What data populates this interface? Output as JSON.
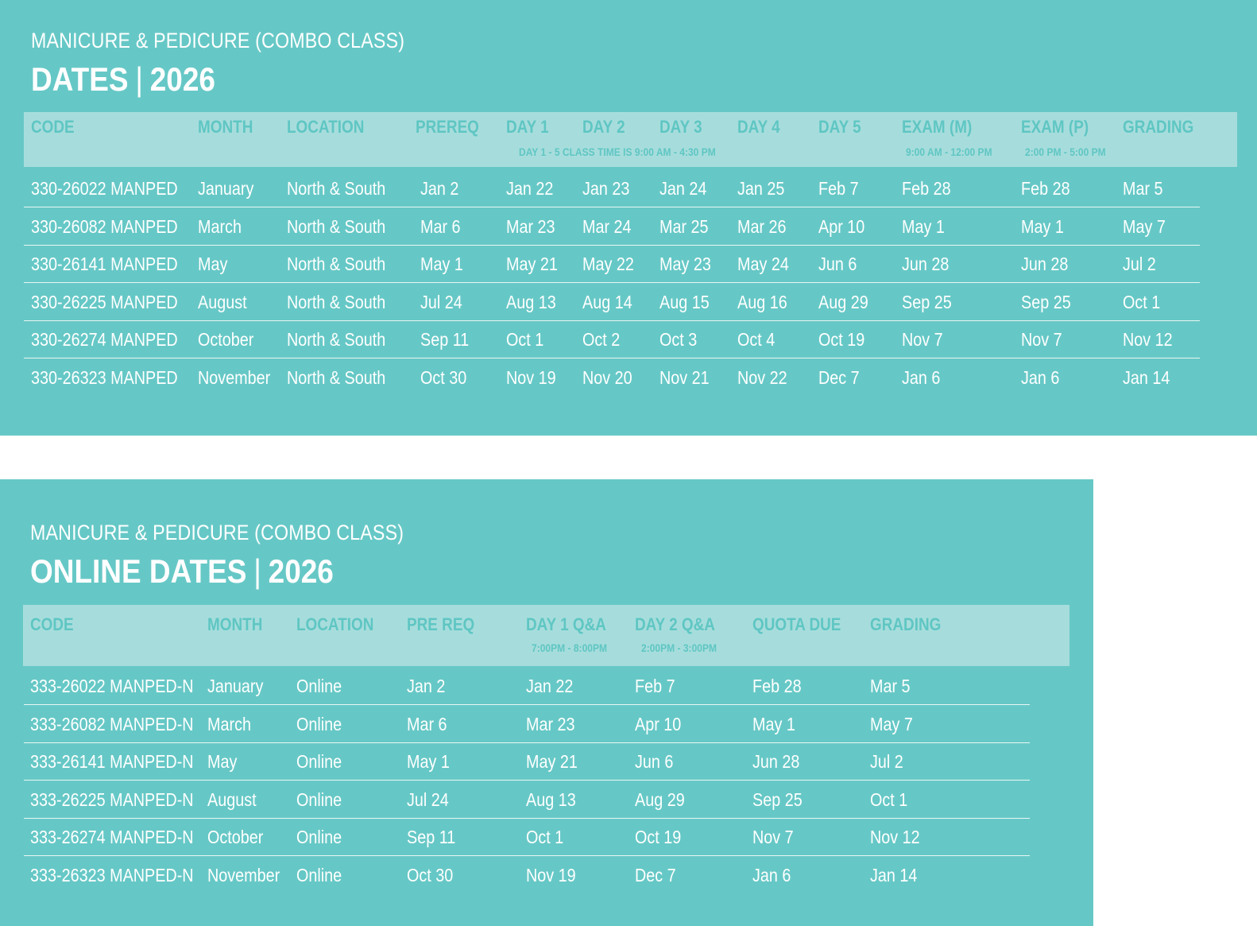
{
  "table1": {
    "subtitle": "MANICURE & PEDICURE (COMBO CLASS)",
    "title_main": "DATES",
    "title_sep": "|",
    "title_year": "2026",
    "headers": [
      "CODE",
      "MONTH",
      "LOCATION",
      "PREREQ",
      "DAY 1",
      "DAY 2",
      "DAY 3",
      "DAY 4",
      "DAY 5",
      "EXAM (M)",
      "EXAM (P)",
      "GRADING"
    ],
    "subheaders": {
      "class_time": "DAY 1 - 5 CLASS TIME IS 9:00 AM - 4:30 PM",
      "exam_m_time": "9:00 AM - 12:00 PM",
      "exam_p_time": "2:00 PM - 5:00 PM"
    },
    "rows": [
      [
        "330-26022 MANPED",
        "January",
        "North & South",
        "Jan 2",
        "Jan 22",
        "Jan 23",
        "Jan 24",
        "Jan 25",
        "Feb 7",
        "Feb 28",
        "Feb 28",
        "Mar 5"
      ],
      [
        "330-26082 MANPED",
        "March",
        "North & South",
        "Mar 6",
        "Mar 23",
        "Mar 24",
        "Mar 25",
        "Mar 26",
        "Apr 10",
        "May 1",
        "May 1",
        "May 7"
      ],
      [
        "330-26141 MANPED",
        "May",
        "North & South",
        "May 1",
        "May 21",
        "May 22",
        "May 23",
        "May 24",
        "Jun 6",
        "Jun 28",
        "Jun 28",
        "Jul 2"
      ],
      [
        "330-26225 MANPED",
        "August",
        "North & South",
        "Jul 24",
        "Aug 13",
        "Aug 14",
        "Aug 15",
        "Aug 16",
        "Aug 29",
        "Sep 25",
        "Sep 25",
        "Oct 1"
      ],
      [
        "330-26274 MANPED",
        "October",
        "North & South",
        "Sep 11",
        "Oct 1",
        "Oct 2",
        "Oct 3",
        "Oct 4",
        "Oct 19",
        "Nov 7",
        "Nov 7",
        "Nov 12"
      ],
      [
        "330-26323 MANPED",
        "November",
        "North & South",
        "Oct 30",
        "Nov 19",
        "Nov 20",
        "Nov 21",
        "Nov 22",
        "Dec 7",
        "Jan 6",
        "Jan 6",
        "Jan 14"
      ]
    ]
  },
  "table2": {
    "subtitle": "MANICURE & PEDICURE (COMBO CLASS)",
    "title_main": "ONLINE DATES",
    "title_sep": "|",
    "title_year": "2026",
    "headers": [
      "CODE",
      "MONTH",
      "LOCATION",
      "PRE REQ",
      "DAY 1 Q&A",
      "DAY 2 Q&A",
      "QUOTA DUE",
      "GRADING"
    ],
    "subheaders": {
      "day1_time": "7:00PM - 8:00PM",
      "day2_time": "2:00PM - 3:00PM"
    },
    "rows": [
      [
        "333-26022 MANPED-N",
        "January",
        "Online",
        "Jan 2",
        "Jan 22",
        "Feb 7",
        "Feb 28",
        "Mar 5"
      ],
      [
        "333-26082 MANPED-N",
        "March",
        "Online",
        "Mar 6",
        "Mar 23",
        "Apr 10",
        "May 1",
        "May 7"
      ],
      [
        "333-26141 MANPED-N",
        "May",
        "Online",
        "May 1",
        "May 21",
        "Jun 6",
        "Jun 28",
        "Jul 2"
      ],
      [
        "333-26225 MANPED-N",
        "August",
        "Online",
        "Jul 24",
        "Aug 13",
        "Aug 29",
        "Sep 25",
        "Oct 1"
      ],
      [
        "333-26274 MANPED-N",
        "October",
        "Online",
        "Sep 11",
        "Oct 1",
        "Oct 19",
        "Nov 7",
        "Nov 12"
      ],
      [
        "333-26323 MANPED-N",
        "November",
        "Online",
        "Oct 30",
        "Nov 19",
        "Dec 7",
        "Jan 6",
        "Jan 14"
      ]
    ]
  },
  "colors": {
    "panel": "#66c8c6",
    "header_bar": "#a6dddc",
    "header_text": "#5fc6c3",
    "body_text": "#ffffff"
  }
}
